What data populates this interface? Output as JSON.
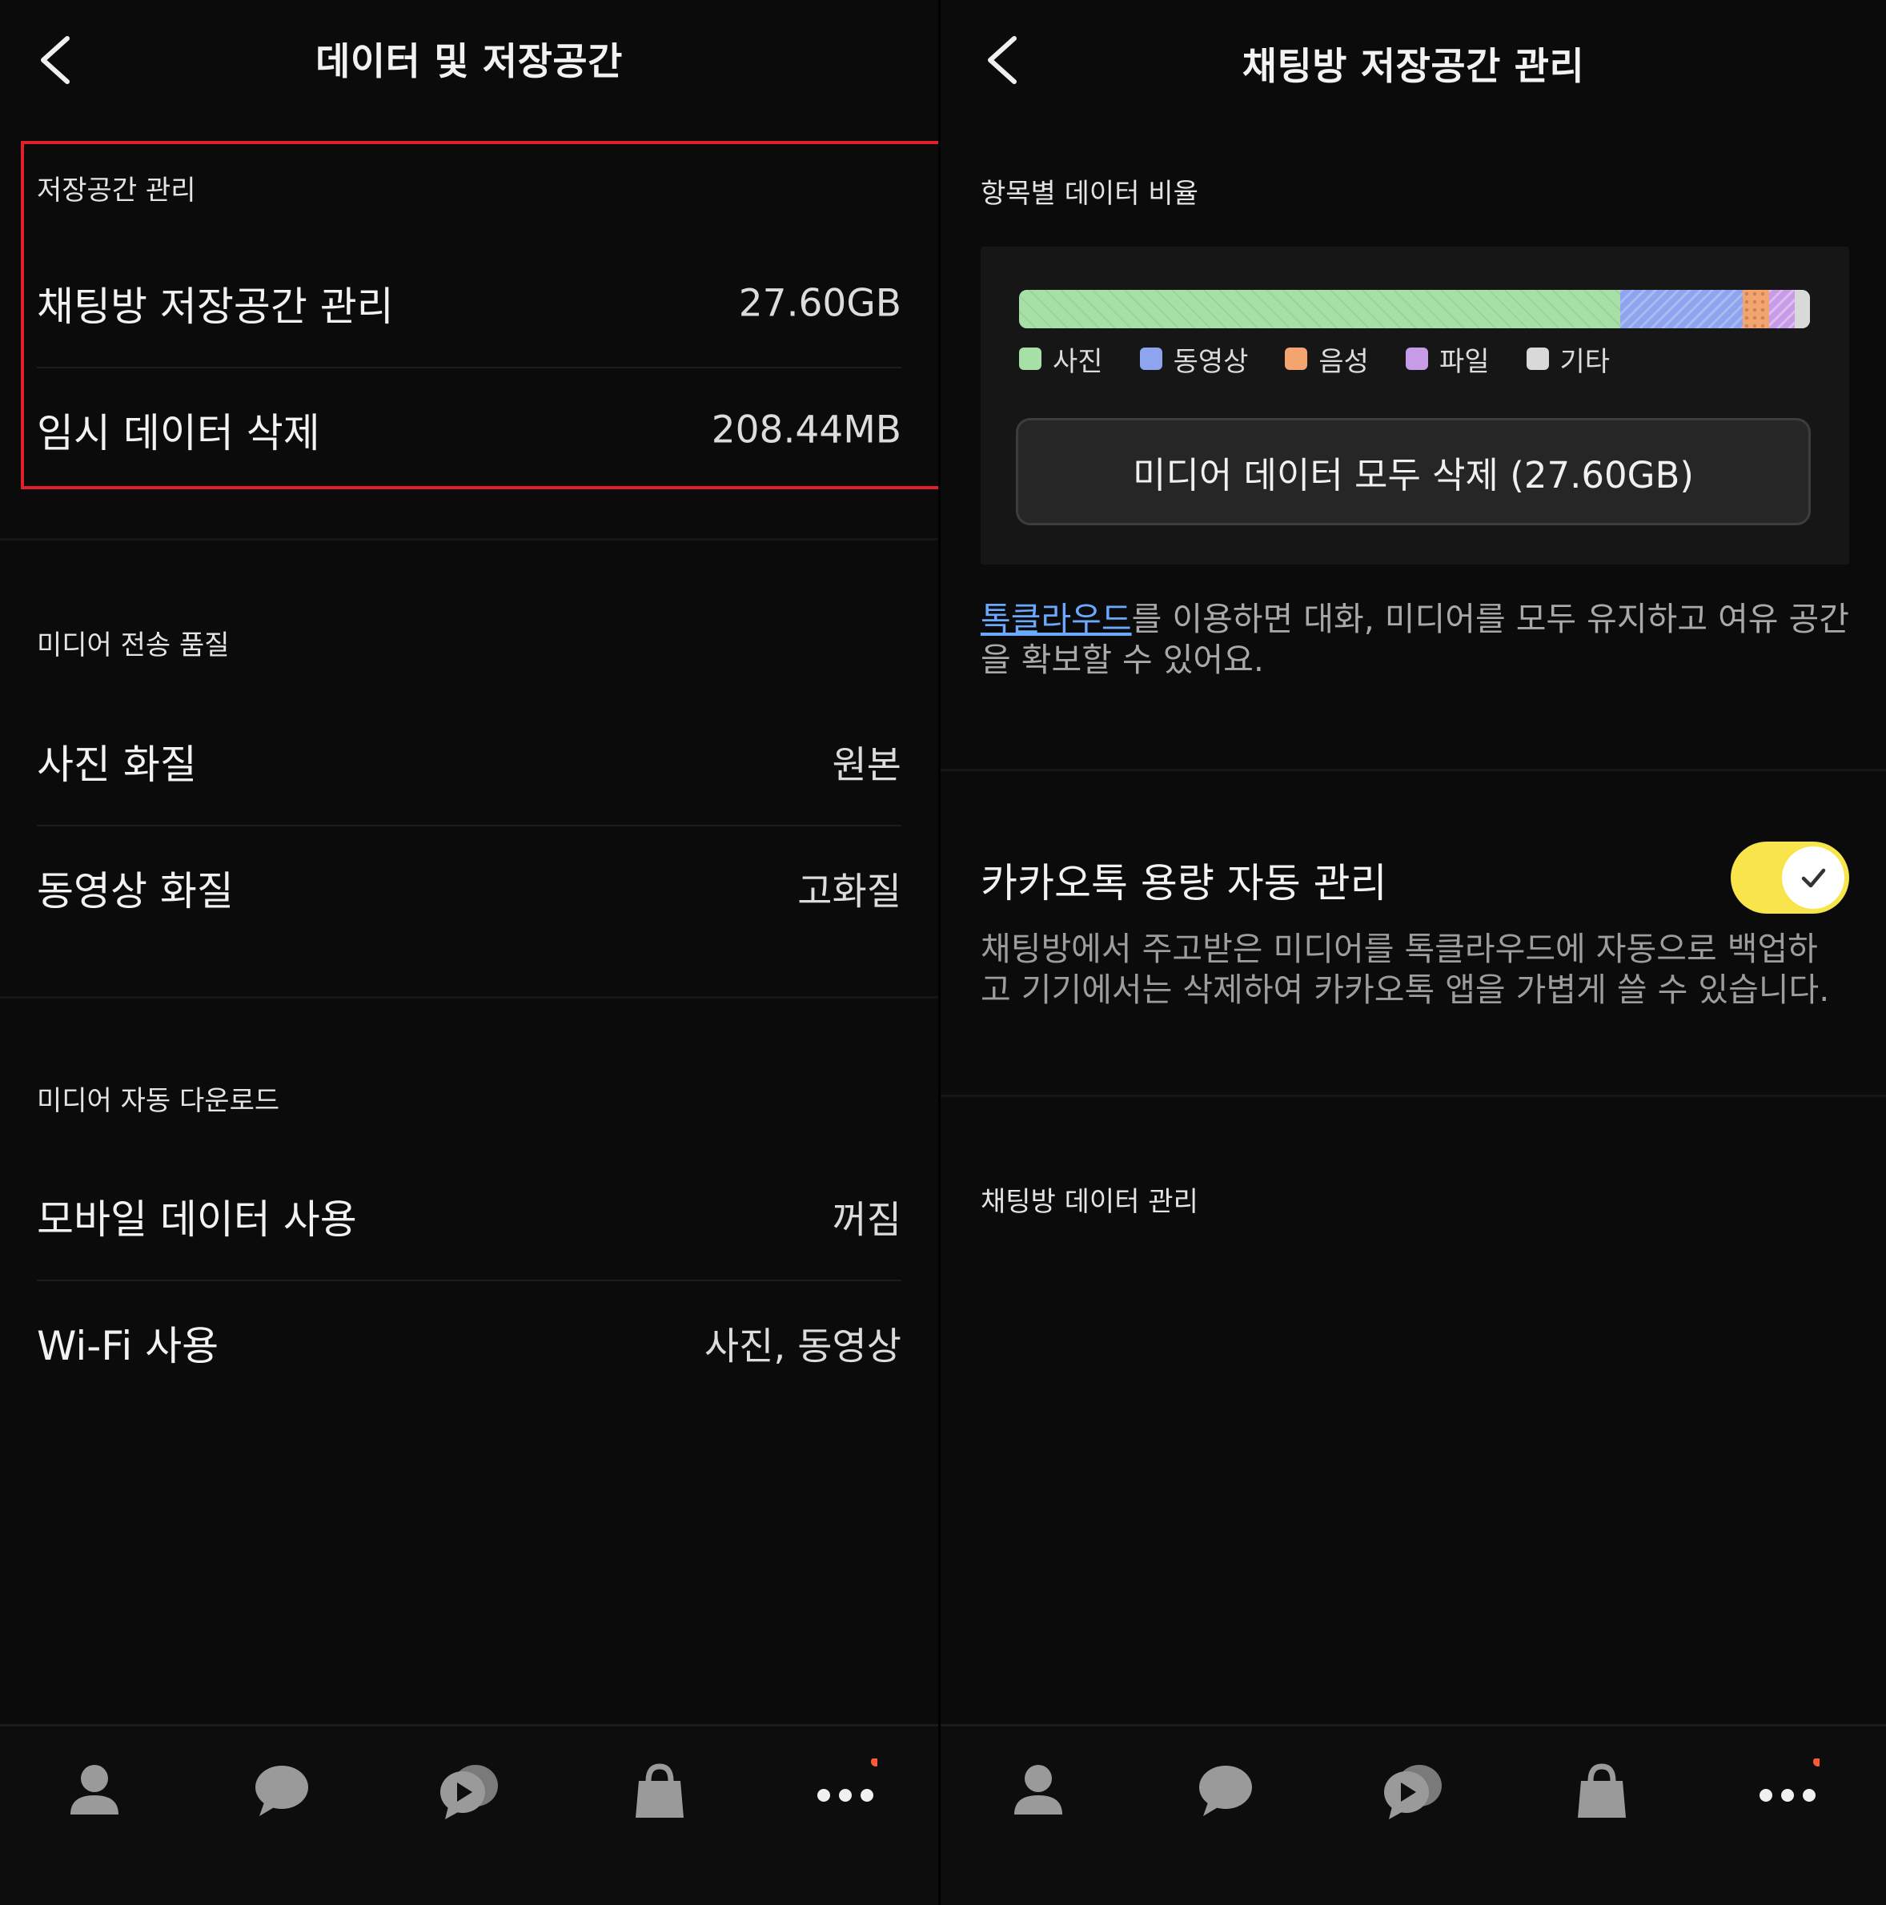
{
  "left": {
    "title": "데이터 및 저장공간",
    "sections": [
      {
        "label": "저장공간 관리",
        "rows": [
          {
            "label": "채팅방 저장공간 관리",
            "value": "27.60GB"
          },
          {
            "label": "임시 데이터 삭제",
            "value": "208.44MB"
          }
        ]
      },
      {
        "label": "미디어 전송 품질",
        "rows": [
          {
            "label": "사진 화질",
            "value": "원본"
          },
          {
            "label": "동영상 화질",
            "value": "고화질"
          }
        ]
      },
      {
        "label": "미디어 자동 다운로드",
        "rows": [
          {
            "label": "모바일 데이터 사용",
            "value": "꺼짐"
          },
          {
            "label": "Wi-Fi 사용",
            "value": "사진, 동영상"
          }
        ]
      }
    ]
  },
  "right": {
    "title": "채팅방 저장공간 관리",
    "ratio_label": "항목별 데이터 비율",
    "storage_bar": [
      {
        "name": "사진",
        "fraction": 0.76,
        "color": "#a6e0a6"
      },
      {
        "name": "동영상",
        "fraction": 0.155,
        "color": "#8ea4ef"
      },
      {
        "name": "음성",
        "fraction": 0.033,
        "color": "#f4a46f"
      },
      {
        "name": "파일",
        "fraction": 0.033,
        "color": "#c89be8"
      },
      {
        "name": "기타",
        "fraction": 0.019,
        "color": "#d9d9d9"
      }
    ],
    "delete_media_button": "미디어 데이터 모두 삭제 (27.60GB)",
    "info_link": "톡클라우드",
    "info_text": "를 이용하면 대화, 미디어를 모두 유지하고 여유 공간을 확보할 수 있어요.",
    "auto_manage_label": "카카오톡 용량 자동 관리",
    "auto_manage_on": true,
    "auto_manage_desc": "채팅방에서 주고받은 미디어를 톡클라우드에 자동으로 백업하고 기기에서는 삭제하여 카카오톡 앱을 가볍게 쓸 수 있습니다.",
    "chat_data_label": "채팅방 데이터 관리"
  },
  "tabs": [
    "friends-icon",
    "chats-icon",
    "openchat-icon",
    "shopping-icon",
    "more-icon"
  ],
  "colors": {
    "highlight": "#e0202a",
    "toggle": "#f7e54b",
    "link": "#6aa9ff",
    "badge": "#ff5a36"
  }
}
